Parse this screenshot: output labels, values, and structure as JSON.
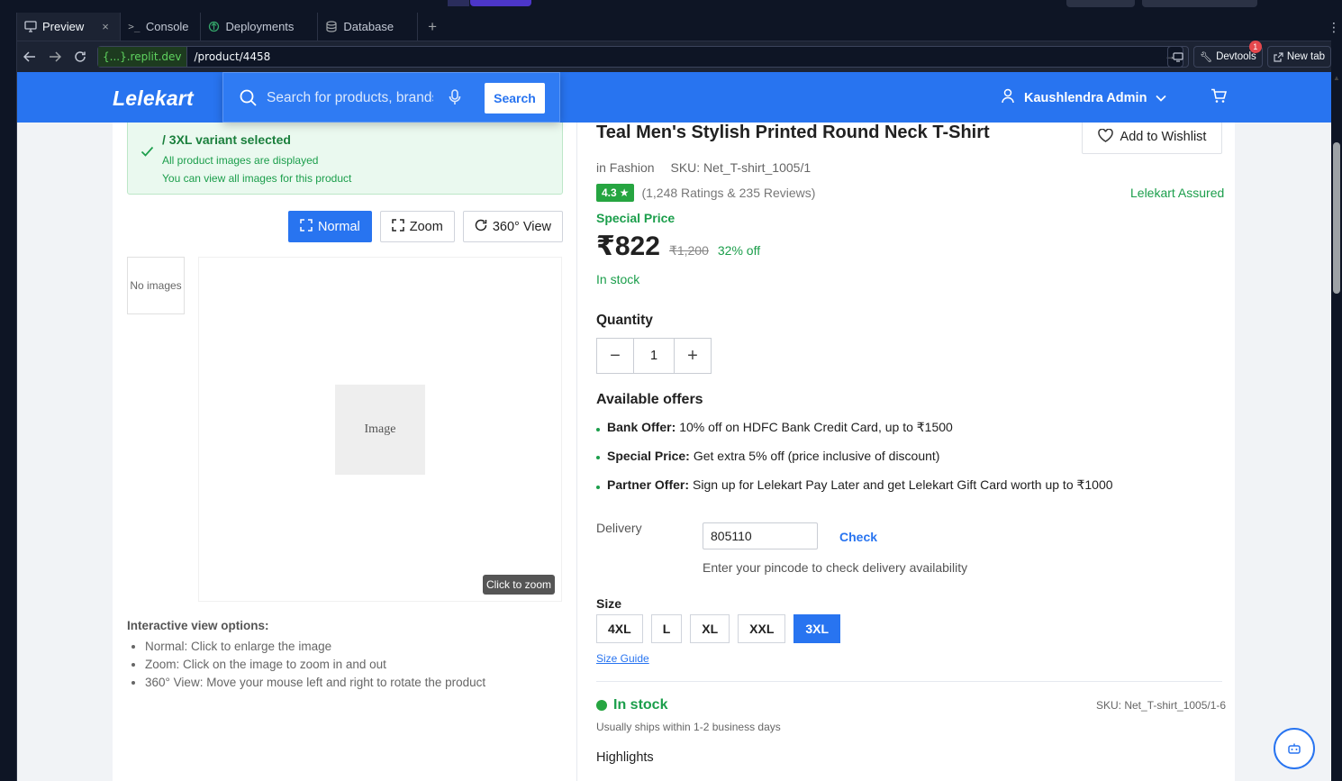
{
  "ide": {
    "tabs": [
      {
        "label": "Preview",
        "icon": "monitor-icon",
        "active": true,
        "closable": true
      },
      {
        "label": "Console",
        "icon": "terminal-icon"
      },
      {
        "label": "Deployments",
        "icon": "rocket-icon"
      },
      {
        "label": "Database",
        "icon": "database-icon"
      }
    ],
    "url_domain": "{...}.replit.dev",
    "url_path": "/product/4458",
    "devtools_label": "Devtools",
    "devtools_badge": "1",
    "new_tab_label": "New tab"
  },
  "header": {
    "logo": "Lelekart",
    "search_placeholder": "Search for products, brands and more",
    "search_button": "Search",
    "user_name": "Kaushlendra Admin"
  },
  "variant": {
    "title": "/ 3XL variant selected",
    "line1": "All product images are displayed",
    "line2": "You can view all images for this product"
  },
  "view_modes": [
    {
      "label": "Normal",
      "active": true
    },
    {
      "label": "Zoom",
      "active": false
    },
    {
      "label": "360° View",
      "active": false
    }
  ],
  "gallery": {
    "thumb_text": "No images",
    "image_alt": "Image",
    "zoom_tip": "Click to zoom"
  },
  "interactive": {
    "title": "Interactive view options:",
    "items": [
      "Normal: Click to enlarge the image",
      "Zoom: Click on the image to zoom in and out",
      "360° View: Move your mouse left and right to rotate the product"
    ]
  },
  "product": {
    "title": "Teal Men's Stylish Printed Round Neck T-Shirt",
    "wishlist": "Add to Wishlist",
    "category": "in Fashion",
    "sku": "SKU: Net_T-shirt_1005/1",
    "rating": "4.3",
    "rating_text": "(1,248 Ratings & 235 Reviews)",
    "assured": "Lelekart Assured",
    "special_price_label": "Special Price",
    "price": "₹822",
    "mrp": "₹1,200",
    "discount": "32% off",
    "stock": "In stock",
    "quantity_label": "Quantity",
    "quantity": "1",
    "offers_title": "Available offers",
    "offers": [
      {
        "bold": "Bank Offer:",
        "text": "10% off on HDFC Bank Credit Card, up to ₹1500"
      },
      {
        "bold": "Special Price:",
        "text": "Get extra 5% off (price inclusive of discount)"
      },
      {
        "bold": "Partner Offer:",
        "text": "Sign up for Lelekart Pay Later and get Lelekart Gift Card worth up to ₹1000"
      }
    ],
    "delivery_label": "Delivery",
    "pincode": "805110",
    "check_label": "Check",
    "pincode_hint": "Enter your pincode to check delivery availability",
    "size_label": "Size",
    "sizes": [
      "4XL",
      "L",
      "XL",
      "XXL",
      "3XL"
    ],
    "selected_size": "3XL",
    "size_guide": "Size Guide",
    "stock_status": "In stock",
    "variant_sku": "SKU: Net_T-shirt_1005/1-6",
    "ships": "Usually ships within 1-2 business days",
    "highlights": "Highlights"
  },
  "colors": {
    "brand": "#2874f0",
    "success": "#1b9e4b",
    "rating_bg": "#26a541"
  }
}
